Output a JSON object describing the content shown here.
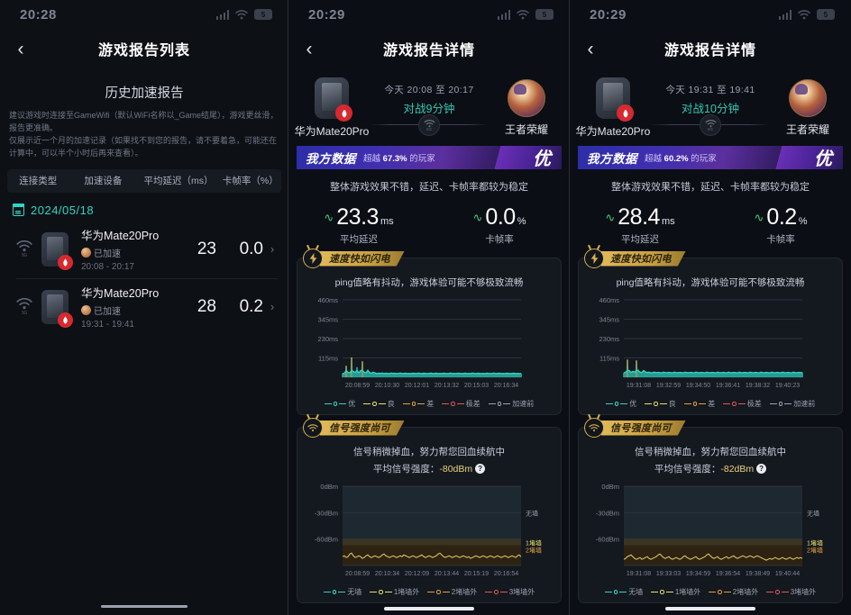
{
  "panel1": {
    "statusbar": {
      "time": "20:28",
      "battery": "5"
    },
    "nav": {
      "back": "‹",
      "title": "游戏报告列表"
    },
    "section_title": "历史加速报告",
    "description": "建议游戏时连接至GameWifi（默认WiFi名称以_Game结尾），游戏更丝滑，报告更准确。\n仅展示近一个月的加速记录（如果找不到您的报告，请不要着急，可能还在计算中，可以半个小时后再来查看）。",
    "table_headers": [
      "连接类型",
      "加速设备",
      "平均延迟（ms）",
      "卡帧率（%）"
    ],
    "date_group": "2024/05/18",
    "records": [
      {
        "wifi_label": "5G",
        "device": "华为Mate20Pro",
        "state": "已加速",
        "time": "20:08 - 20:17",
        "latency": "23",
        "frameloss": "0.0",
        "arrow": "›"
      },
      {
        "wifi_label": "5G",
        "device": "华为Mate20Pro",
        "state": "已加速",
        "time": "19:31 - 19:41",
        "latency": "28",
        "frameloss": "0.2",
        "arrow": "›"
      }
    ]
  },
  "panel2": {
    "statusbar": {
      "time": "20:29",
      "battery": "5"
    },
    "nav": {
      "back": "‹",
      "title": "游戏报告详情"
    },
    "device_name": "华为Mate20Pro",
    "game_name": "王者荣耀",
    "session_date": "今天 20:08 至 20:17",
    "session_duration": "对战9分钟",
    "wifi_label": "5G",
    "banner": {
      "title": "我方数据",
      "sub_prefix": "超越",
      "sub_value": "67.3%",
      "sub_suffix": "的玩家",
      "grade": "优"
    },
    "summary": "整体游戏效果不错，延迟、卡帧率都较为稳定",
    "metrics": [
      {
        "num": "23.3",
        "unit": "ms",
        "caption": "平均延迟"
      },
      {
        "num": "0.0",
        "unit": "%",
        "caption": "卡帧率"
      }
    ],
    "ping_card": {
      "tag": "速度快如闪电",
      "headline": "ping值略有抖动，游戏体验可能不够极致流畅"
    },
    "signal_card": {
      "tag": "信号强度尚可",
      "headline": "信号稍微掉血，努力帮您回血续航中",
      "avg_label": "平均信号强度：",
      "avg_value": "-80dBm",
      "qmark": "?"
    }
  },
  "panel3": {
    "statusbar": {
      "time": "20:29",
      "battery": "5"
    },
    "nav": {
      "back": "‹",
      "title": "游戏报告详情"
    },
    "device_name": "华为Mate20Pro",
    "game_name": "王者荣耀",
    "session_date": "今天 19:31 至 19:41",
    "session_duration": "对战10分钟",
    "wifi_label": "5G",
    "banner": {
      "title": "我方数据",
      "sub_prefix": "超越",
      "sub_value": "60.2%",
      "sub_suffix": "的玩家",
      "grade": "优"
    },
    "summary": "整体游戏效果不错，延迟、卡帧率都较为稳定",
    "metrics": [
      {
        "num": "28.4",
        "unit": "ms",
        "caption": "平均延迟"
      },
      {
        "num": "0.2",
        "unit": "%",
        "caption": "卡帧率"
      }
    ],
    "ping_card": {
      "tag": "速度快如闪电",
      "headline": "ping值略有抖动，游戏体验可能不够极致流畅"
    },
    "signal_card": {
      "tag": "信号强度尚可",
      "headline": "信号稍微掉血，努力帮您回血续航中",
      "avg_label": "平均信号强度：",
      "avg_value": "-82dBm",
      "qmark": "?"
    }
  },
  "colors": {
    "excellent": "#2fd6c5",
    "good": "#e8e06a",
    "poor": "#e0a23c",
    "very_poor": "#e05a5a",
    "before_accel": "#9aa2af",
    "accent_green": "#3cd07a",
    "gold": "#d8b14e"
  },
  "chart_data": [
    {
      "id": "p2-ping",
      "type": "line",
      "title": "ping值略有抖动，游戏体验可能不够极致流畅",
      "ylabel": "ms",
      "ylim": [
        0,
        460
      ],
      "yticks": [
        115,
        230,
        345,
        460
      ],
      "ytick_labels": [
        "115ms",
        "230ms",
        "345ms",
        "460ms"
      ],
      "xtick_labels": [
        "20:08:59",
        "20:10:30",
        "20:12:01",
        "20:13:32",
        "20:15:03",
        "20:16:34"
      ],
      "legend": [
        "优",
        "良",
        "差",
        "极差",
        "加速前"
      ],
      "legend_colors": [
        "#2fd6c5",
        "#e8e06a",
        "#e0a23c",
        "#e05a5a",
        "#9aa2af"
      ],
      "grid": true,
      "series": [
        {
          "name": "ping",
          "values": [
            22,
            24,
            68,
            30,
            26,
            118,
            35,
            28,
            60,
            25,
            40,
            95,
            30,
            26,
            45,
            28,
            24,
            30,
            26,
            22,
            24,
            23,
            25,
            22,
            24,
            23,
            22,
            25,
            23,
            24,
            22,
            23,
            25,
            22,
            23,
            24,
            22,
            23,
            22,
            24,
            23,
            22,
            25,
            23,
            22,
            24,
            23,
            22,
            23,
            25,
            22,
            23,
            24,
            22,
            23,
            22,
            24,
            23,
            22,
            23,
            25,
            22,
            23,
            22,
            24,
            23,
            22,
            23,
            24,
            22,
            23,
            22,
            25,
            23,
            22,
            24,
            23,
            22,
            23,
            22,
            24,
            23,
            22,
            23,
            25,
            22,
            23,
            24,
            22,
            23,
            22,
            24,
            23,
            22,
            23,
            24,
            22,
            23,
            22,
            23
          ]
        }
      ]
    },
    {
      "id": "p2-signal",
      "type": "line",
      "title": "信号稍微掉血，努力帮您回血续航中",
      "ylabel": "dBm",
      "ylim": [
        -90,
        0
      ],
      "yticks": [
        0,
        -30,
        -60
      ],
      "ytick_labels": [
        "0dBm",
        "-30dBm",
        "-60dBm"
      ],
      "xtick_labels": [
        "20:08:59",
        "20:10:34",
        "20:12:09",
        "20:13:44",
        "20:15:19",
        "20:16:54"
      ],
      "legend": [
        "无墙",
        "1堵墙外",
        "2堵墙外",
        "3堵墙外"
      ],
      "legend_colors": [
        "#2fd6c5",
        "#e8e06a",
        "#e0a23c",
        "#e05a5a"
      ],
      "right_labels": [
        "无墙",
        "1堵墙",
        "2堵墙"
      ],
      "right_label_colors": [
        "#9aa2af",
        "#e8e06a",
        "#e0a23c"
      ],
      "grid": true,
      "series": [
        {
          "name": "signal",
          "values": [
            -80,
            -79,
            -81,
            -80,
            -77,
            -76,
            -79,
            -81,
            -80,
            -79,
            -80,
            -82,
            -81,
            -79,
            -78,
            -80,
            -81,
            -80,
            -79,
            -80,
            -81,
            -80,
            -78,
            -77,
            -79,
            -80,
            -81,
            -80,
            -79,
            -80,
            -81,
            -80,
            -79,
            -80,
            -78,
            -79,
            -80,
            -81,
            -80,
            -79,
            -80,
            -81,
            -80,
            -79,
            -78,
            -80,
            -81,
            -80,
            -79,
            -80,
            -81,
            -80,
            -79,
            -77,
            -76,
            -78,
            -80,
            -81,
            -80,
            -79,
            -80,
            -81,
            -80,
            -79,
            -80,
            -81,
            -80,
            -79,
            -80,
            -81,
            -80,
            -82,
            -81,
            -80,
            -79,
            -80,
            -81,
            -80,
            -79,
            -80,
            -81,
            -80,
            -79,
            -80,
            -81,
            -80,
            -79,
            -80,
            -81,
            -80,
            -79,
            -80,
            -81,
            -80,
            -79,
            -80,
            -81,
            -79,
            -78,
            -80
          ]
        }
      ]
    },
    {
      "id": "p3-ping",
      "type": "line",
      "title": "ping值略有抖动，游戏体验可能不够极致流畅",
      "ylabel": "ms",
      "ylim": [
        0,
        460
      ],
      "yticks": [
        115,
        230,
        345,
        460
      ],
      "ytick_labels": [
        "115ms",
        "230ms",
        "345ms",
        "460ms"
      ],
      "xtick_labels": [
        "19:31:08",
        "19:32:59",
        "19:34:50",
        "19:36:41",
        "19:38:32",
        "19:40:23"
      ],
      "legend": [
        "优",
        "良",
        "差",
        "极差",
        "加速前"
      ],
      "legend_colors": [
        "#2fd6c5",
        "#e8e06a",
        "#e0a23c",
        "#e05a5a",
        "#9aa2af"
      ],
      "grid": true,
      "series": [
        {
          "name": "ping",
          "values": [
            26,
            30,
            105,
            40,
            28,
            35,
            30,
            100,
            45,
            30,
            28,
            40,
            32,
            28,
            30,
            26,
            28,
            30,
            27,
            29,
            28,
            26,
            30,
            28,
            27,
            29,
            28,
            26,
            30,
            28,
            27,
            29,
            28,
            26,
            30,
            28,
            27,
            29,
            28,
            26,
            30,
            28,
            27,
            29,
            28,
            26,
            30,
            28,
            27,
            29,
            28,
            26,
            30,
            28,
            27,
            29,
            28,
            26,
            30,
            28,
            27,
            29,
            28,
            26,
            30,
            28,
            27,
            29,
            28,
            26,
            30,
            28,
            27,
            29,
            28,
            26,
            30,
            28,
            27,
            29,
            28,
            26,
            30,
            28,
            27,
            29,
            28,
            26,
            30,
            28,
            27,
            29,
            28,
            26,
            30,
            28,
            27,
            29,
            28,
            28
          ]
        }
      ]
    },
    {
      "id": "p3-signal",
      "type": "line",
      "title": "信号稍微掉血，努力帮您回血续航中",
      "ylabel": "dBm",
      "ylim": [
        -90,
        0
      ],
      "yticks": [
        0,
        -30,
        -60
      ],
      "ytick_labels": [
        "0dBm",
        "-30dBm",
        "-60dBm"
      ],
      "xtick_labels": [
        "19:31:08",
        "19:33:03",
        "19:34:59",
        "19:36:54",
        "19:38:49",
        "19:40:44"
      ],
      "legend": [
        "无墙",
        "1堵墙外",
        "2堵墙外",
        "3堵墙外"
      ],
      "legend_colors": [
        "#2fd6c5",
        "#e8e06a",
        "#e0a23c",
        "#e05a5a"
      ],
      "right_labels": [
        "无墙",
        "1堵墙",
        "2堵墙"
      ],
      "right_label_colors": [
        "#9aa2af",
        "#e8e06a",
        "#e0a23c"
      ],
      "grid": true,
      "series": [
        {
          "name": "signal",
          "values": [
            -83,
            -82,
            -80,
            -79,
            -78,
            -80,
            -82,
            -83,
            -82,
            -81,
            -83,
            -82,
            -81,
            -80,
            -82,
            -83,
            -82,
            -81,
            -80,
            -78,
            -77,
            -79,
            -81,
            -82,
            -81,
            -80,
            -82,
            -83,
            -82,
            -81,
            -82,
            -83,
            -82,
            -80,
            -79,
            -81,
            -82,
            -83,
            -82,
            -81,
            -80,
            -82,
            -83,
            -82,
            -81,
            -80,
            -78,
            -77,
            -79,
            -81,
            -82,
            -81,
            -80,
            -82,
            -83,
            -82,
            -81,
            -80,
            -82,
            -81,
            -80,
            -79,
            -81,
            -82,
            -81,
            -80,
            -79,
            -80,
            -81,
            -80,
            -79,
            -80,
            -81,
            -80,
            -79,
            -80,
            -81,
            -82,
            -83,
            -84,
            -83,
            -82,
            -83,
            -82,
            -81,
            -82,
            -83,
            -82,
            -81,
            -82,
            -83,
            -82,
            -81,
            -82,
            -83,
            -82,
            -81,
            -82,
            -81,
            -82
          ]
        }
      ]
    }
  ]
}
